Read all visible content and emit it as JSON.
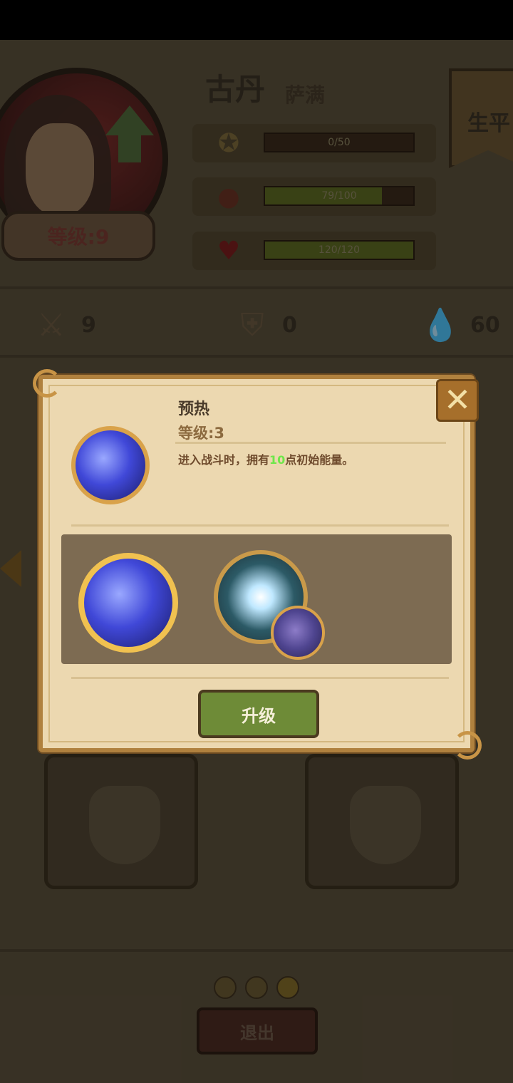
{
  "hero": {
    "name": "古丹",
    "class": "萨满",
    "level_label": "等级:9",
    "profile_tab": "生平"
  },
  "stats": [
    {
      "icon": "medal-icon",
      "value": "0/50",
      "fill": 0.0
    },
    {
      "icon": "stomach-icon",
      "value": "79/100",
      "fill": 0.79
    },
    {
      "icon": "heart-icon",
      "value": "120/120",
      "fill": 1.0
    }
  ],
  "attributes": {
    "attack": "9",
    "defense": "0",
    "energy": "60"
  },
  "modal": {
    "skill_name": "预热",
    "skill_level": "等级:3",
    "desc_prefix": "进入战斗时，拥有",
    "desc_value": "10",
    "desc_suffix": "点初始能量。",
    "upgrade_label": "升级",
    "close_icon": "close-icon"
  },
  "pagination": {
    "count": 3,
    "active": 3
  },
  "footer": {
    "exit_label": "退出"
  },
  "colors": {
    "modal_bg": "#ecd8b0",
    "modal_border": "#b0813e",
    "upgrade_green": "#6e8b37",
    "highlight_green": "#6fe64a"
  }
}
